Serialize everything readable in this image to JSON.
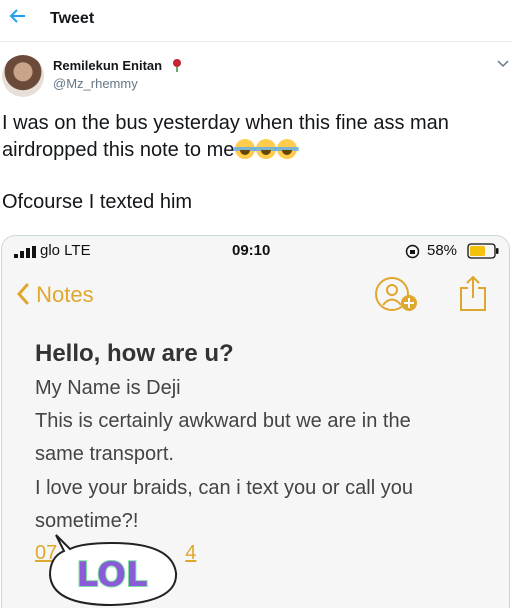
{
  "header": {
    "title": "Tweet",
    "back_icon": "arrow-left-icon"
  },
  "tweet": {
    "author_name": "Remilekun Enitan",
    "author_handle": "@Mz_rhemmy",
    "name_emoji": "rose-icon",
    "line1": "I was on the bus yesterday when this fine ass man",
    "line2": "airdropped this note to me",
    "line2_emoji": "face-with-tears-of-joy x3",
    "line3": "Ofcourse I texted him"
  },
  "phone": {
    "status": {
      "carrier": "glo  LTE",
      "time": "09:10",
      "battery": "58%"
    },
    "notes_back": "Notes",
    "note": {
      "title": "Hello, how are u?",
      "lines": [
        "My Name is Deji",
        "This is certainly awkward but we are in the",
        "same transport.",
        "I love your braids, can i text you or call you",
        "sometime?!"
      ],
      "number_fragments": [
        "07",
        "4"
      ]
    },
    "sticker_text": "LOL"
  },
  "colors": {
    "twitter_blue": "#1da1f2",
    "notes_yellow": "#e0a72e",
    "sticker_purple": "#8a5ad8",
    "sticker_green": "#7ee0a0"
  }
}
